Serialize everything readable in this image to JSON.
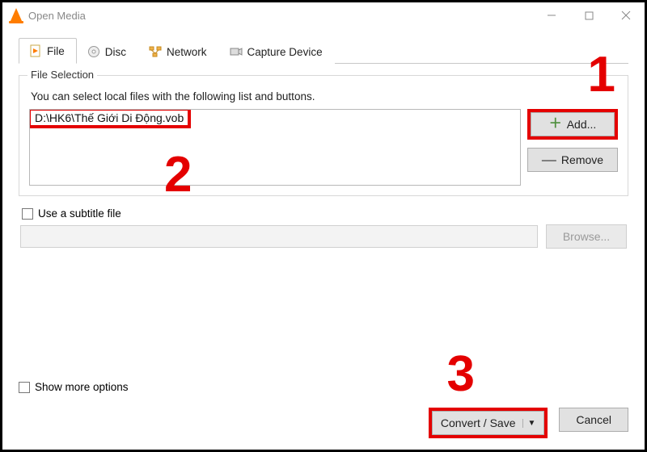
{
  "window": {
    "title": "Open Media"
  },
  "tabs": {
    "file": "File",
    "disc": "Disc",
    "network": "Network",
    "capture": "Capture Device"
  },
  "fileSelection": {
    "legend": "File Selection",
    "help": "You can select local files with the following list and buttons.",
    "entry": "D:\\HK6\\Thế Giới Di Động.vob",
    "add": "Add...",
    "remove": "Remove"
  },
  "subtitle": {
    "label": "Use a subtitle file",
    "browse": "Browse..."
  },
  "more": "Show more options",
  "actions": {
    "convert": "Convert / Save",
    "cancel": "Cancel"
  },
  "annotations": {
    "n1": "1",
    "n2": "2",
    "n3": "3"
  }
}
